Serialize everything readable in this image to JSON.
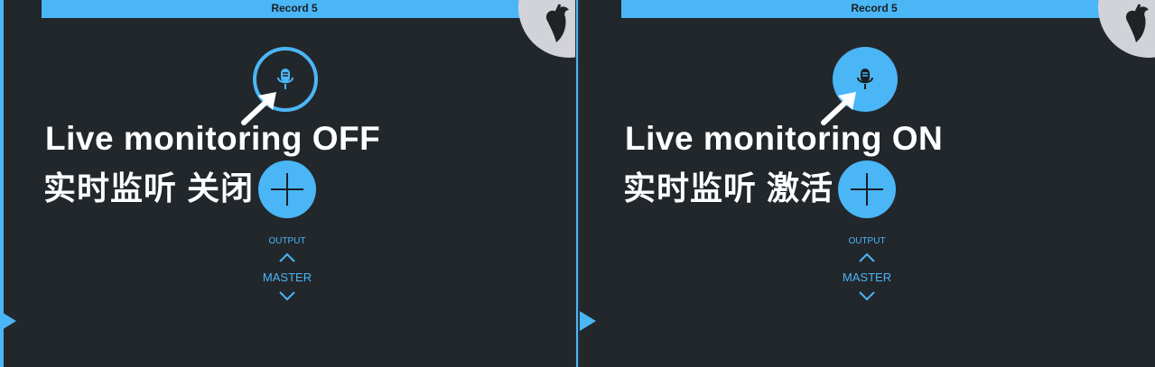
{
  "accent_color": "#4ab6f5",
  "background_color": "#22272c",
  "panels": [
    {
      "record_title": "Record 5",
      "mic_state": "off",
      "caption_en": "Live monitoring OFF",
      "caption_cn": "实时监听 关闭",
      "output_label": "OUTPUT",
      "master_label": "MASTER"
    },
    {
      "record_title": "Record 5",
      "mic_state": "on",
      "caption_en": "Live monitoring ON",
      "caption_cn": "实时监听 激活",
      "output_label": "OUTPUT",
      "master_label": "MASTER"
    }
  ],
  "icons": {
    "logo": "fl-studio-fruit-logo-icon",
    "mic": "microphone-icon",
    "add": "plus-icon",
    "up": "chevron-up-icon",
    "down": "chevron-down-icon",
    "pointer": "arrow-pointer-icon"
  }
}
